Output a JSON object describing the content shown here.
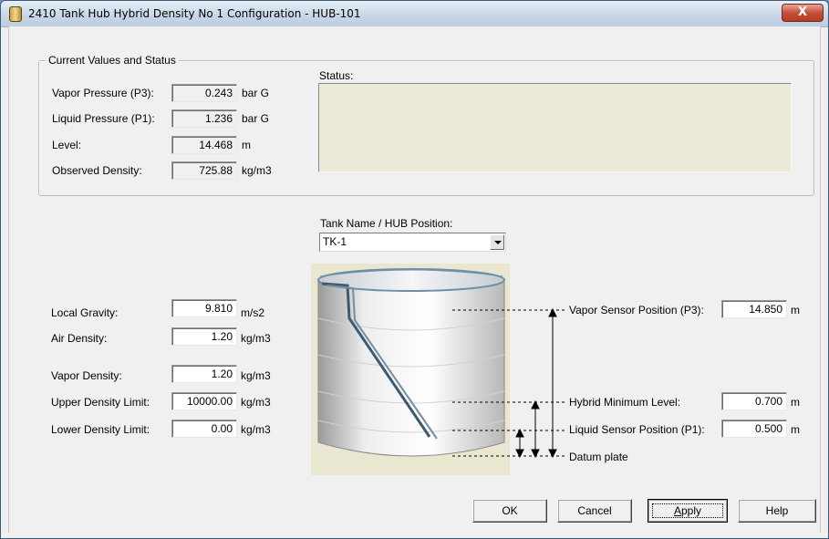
{
  "window": {
    "title": "2410 Tank Hub Hybrid Density No 1 Configuration - HUB-101",
    "close_symbol": "X"
  },
  "current_values": {
    "group_title": "Current Values and Status",
    "vapor_pressure": {
      "label": "Vapor Pressure (P3):",
      "value": "0.243",
      "unit": "bar G"
    },
    "liquid_pressure": {
      "label": "Liquid Pressure (P1):",
      "value": "1.236",
      "unit": "bar G"
    },
    "level": {
      "label": "Level:",
      "value": "14.468",
      "unit": "m"
    },
    "observed_density": {
      "label": "Observed Density:",
      "value": "725.88",
      "unit": "kg/m3"
    },
    "status_label": "Status:",
    "status_value": ""
  },
  "tank": {
    "label": "Tank Name / HUB Position:",
    "selected": "TK-1"
  },
  "parameters": {
    "local_gravity": {
      "label": "Local Gravity:",
      "value": "9.810",
      "unit": "m/s2"
    },
    "air_density": {
      "label": "Air Density:",
      "value": "1.20",
      "unit": "kg/m3"
    },
    "vapor_density": {
      "label": "Vapor Density:",
      "value": "1.20",
      "unit": "kg/m3"
    },
    "upper_density_limit": {
      "label": "Upper Density Limit:",
      "value": "10000.00",
      "unit": "kg/m3"
    },
    "lower_density_limit": {
      "label": "Lower Density Limit:",
      "value": "0.00",
      "unit": "kg/m3"
    }
  },
  "positions": {
    "vapor_sensor": {
      "label": "Vapor Sensor Position (P3):",
      "value": "14.850",
      "unit": "m"
    },
    "hybrid_min_level": {
      "label": "Hybrid Minimum Level:",
      "value": "0.700",
      "unit": "m"
    },
    "liquid_sensor": {
      "label": "Liquid Sensor Position (P1):",
      "value": "0.500",
      "unit": "m"
    },
    "datum_plate": {
      "label": "Datum plate"
    }
  },
  "buttons": {
    "ok": "OK",
    "cancel": "Cancel",
    "apply_accel": "A",
    "apply_rest": "pply",
    "help": "Help"
  }
}
